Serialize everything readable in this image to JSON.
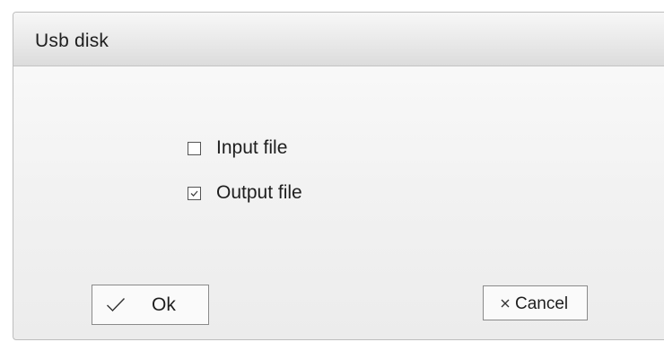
{
  "dialog": {
    "title": "Usb disk"
  },
  "options": [
    {
      "label": "Input file",
      "checked": false
    },
    {
      "label": "Output file",
      "checked": true
    }
  ],
  "buttons": {
    "ok": {
      "label": "Ok",
      "icon": "checkmark-icon"
    },
    "cancel": {
      "label": "Cancel",
      "icon": "close-icon"
    }
  }
}
